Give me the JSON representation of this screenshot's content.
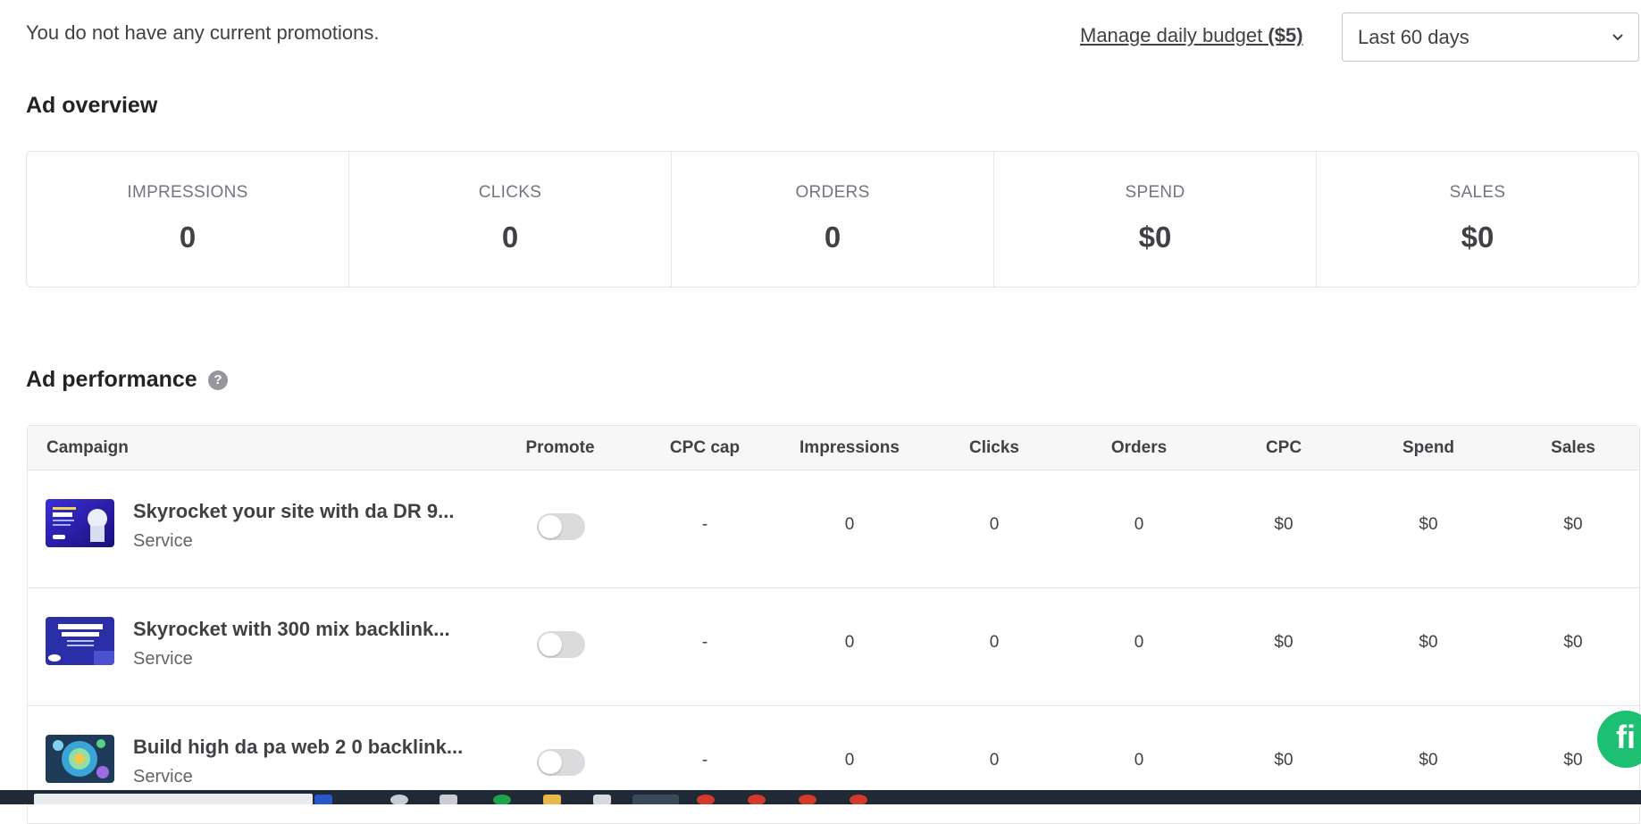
{
  "header": {
    "no_promotions_text": "You do not have any current promotions.",
    "manage_budget_label": "Manage daily budget",
    "manage_budget_amount": "($5)",
    "date_range": "Last 60 days"
  },
  "overview": {
    "title": "Ad overview",
    "stats": [
      {
        "label": "IMPRESSIONS",
        "value": "0"
      },
      {
        "label": "CLICKS",
        "value": "0"
      },
      {
        "label": "ORDERS",
        "value": "0"
      },
      {
        "label": "SPEND",
        "value": "$0"
      },
      {
        "label": "SALES",
        "value": "$0"
      }
    ]
  },
  "performance": {
    "title": "Ad performance",
    "help_glyph": "?",
    "columns": [
      "Campaign",
      "Promote",
      "CPC cap",
      "Impressions",
      "Clicks",
      "Orders",
      "CPC",
      "Spend",
      "Sales"
    ],
    "rows": [
      {
        "title": "Skyrocket your site with da DR 9...",
        "type": "Service",
        "promote": false,
        "cpc_cap": "-",
        "impressions": "0",
        "clicks": "0",
        "orders": "0",
        "cpc": "$0",
        "spend": "$0",
        "sales": "$0"
      },
      {
        "title": "Skyrocket with 300 mix backlink...",
        "type": "Service",
        "promote": false,
        "cpc_cap": "-",
        "impressions": "0",
        "clicks": "0",
        "orders": "0",
        "cpc": "$0",
        "spend": "$0",
        "sales": "$0"
      },
      {
        "title": "Build high da pa web 2 0 backlink...",
        "type": "Service",
        "promote": false,
        "cpc_cap": "-",
        "impressions": "0",
        "clicks": "0",
        "orders": "0",
        "cpc": "$0",
        "spend": "$0",
        "sales": "$0"
      }
    ]
  },
  "chat_button_glyph": "fi",
  "colors": {
    "accent_green": "#1dbf73",
    "text_dark": "#404145",
    "muted": "#74767e",
    "taskbar": "#1f2a36"
  }
}
